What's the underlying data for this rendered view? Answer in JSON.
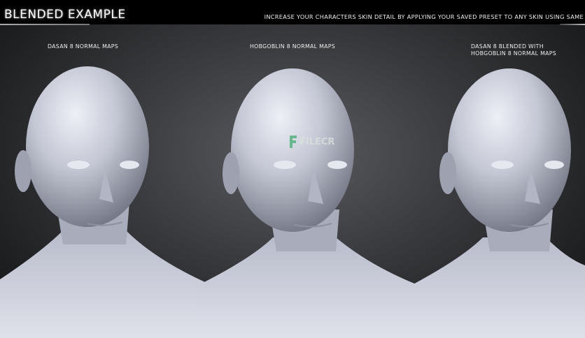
{
  "header": {
    "title": "BLENDED EXAMPLE",
    "tagline": "INCREASE YOUR CHARACTERS SKIN DETAIL BY APPLYING YOUR SAVED PRESET TO ANY SKIN USING SAME"
  },
  "panels": [
    {
      "label_line1": "DASAN 8 NORMAL MAPS",
      "label_line2": ""
    },
    {
      "label_line1": "HOBGOBLIN 8 NORMAL MAPS",
      "label_line2": ""
    },
    {
      "label_line1": "DASAN 8 BLENDED WITH",
      "label_line2": "HOBGOBLIN 8 NORMAL MAPS"
    }
  ],
  "watermark": "FILECR",
  "colors": {
    "skin": "#c9ccd8",
    "background": "#3b3c3f",
    "header": "#000000"
  }
}
